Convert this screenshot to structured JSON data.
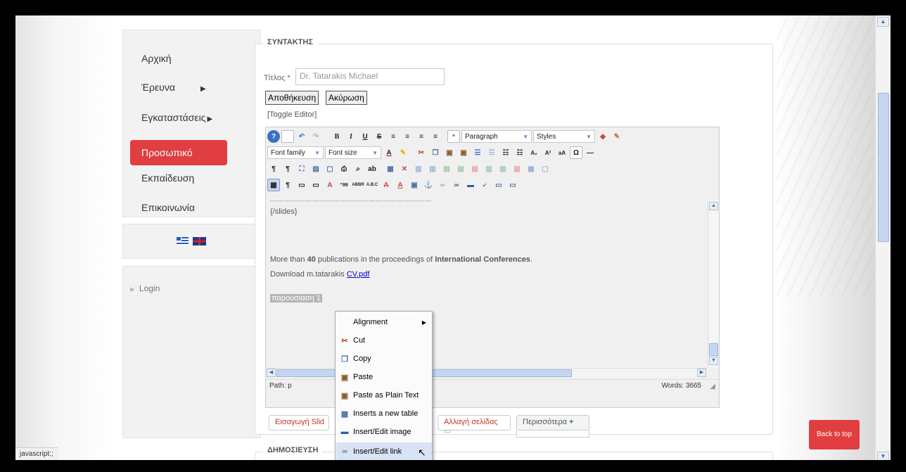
{
  "nav": {
    "items": [
      {
        "label": "Αρχική"
      },
      {
        "label": "Έρευνα",
        "arrow": "▶"
      },
      {
        "label": "Εγκαταστάσεις",
        "arrow": "▶"
      },
      {
        "label": "Προσωπικό",
        "active": true
      },
      {
        "label": "Εκπαίδευση"
      },
      {
        "label": "Επικοινωνία"
      }
    ]
  },
  "login_label": "Login",
  "editor_section": {
    "legend": "ΣΥΝΤΑΚΤΗΣ",
    "title_label": "Τίτλος *",
    "title_value": "Dr. Tatarakis Michael",
    "save_label": "Αποθήκευση",
    "cancel_label": "Ακύρωση",
    "toggle_label": "[Toggle Editor]"
  },
  "toolbar": {
    "format_select": "Paragraph",
    "styles_select": "Styles",
    "font_family": "Font family",
    "font_size": "Font size"
  },
  "content": {
    "slides_tag": "{/slides}",
    "pub_prefix": "More than ",
    "pub_count": "40",
    "pub_mid": " publications in the proceedings of ",
    "pub_bold": "International Conferences",
    "pub_end": ".",
    "download_prefix": "Download m.tatarakis ",
    "download_link": "CV.pdf",
    "selected_text": "παρουσιαση 1"
  },
  "statusbar": {
    "path": "Path: p",
    "words": "Words: 3665"
  },
  "extra_buttons": {
    "insert_slide": "Εισαγωγή Slid",
    "page_break": "Αλλαγή σελίδας",
    "more": "Περισσότερα"
  },
  "publish_legend": "ΔΗΜΟΣΙΕΥΣΗ",
  "context_menu": {
    "items": [
      {
        "label": "Alignment",
        "icon": "none",
        "submenu": true
      },
      {
        "label": "Cut",
        "icon": "scissors-icon",
        "color": "#c0392b"
      },
      {
        "label": "Copy",
        "icon": "copy-icon",
        "color": "#4a6fa5"
      },
      {
        "label": "Paste",
        "icon": "paste-icon",
        "color": "#8a5a2b"
      },
      {
        "label": "Paste as Plain Text",
        "icon": "paste-text-icon",
        "color": "#8a5a2b"
      },
      {
        "label": "Inserts a new table",
        "icon": "table-icon",
        "color": "#4a6fa5"
      },
      {
        "label": "Insert/Edit image",
        "icon": "image-icon",
        "color": "#2f5f9e"
      },
      {
        "label": "Insert/Edit link",
        "icon": "link-icon",
        "color": "#777",
        "highlight": true
      }
    ]
  },
  "back_to_top": "Back to top",
  "browser_status": "javascript:;"
}
